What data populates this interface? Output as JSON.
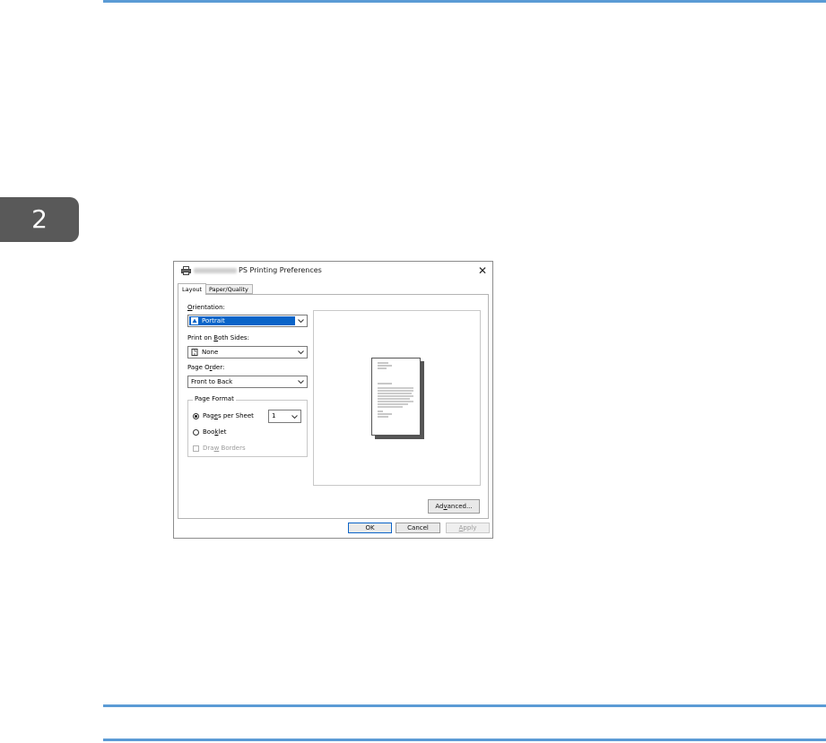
{
  "chapter_number": "2",
  "colors": {
    "rule": "#5b9bd5",
    "chapter_tab": "#595959",
    "selection": "#0a64c8"
  },
  "dialog": {
    "title": "PS Printing Preferences",
    "icons": {
      "printer": "printer-icon",
      "close": "close-icon"
    },
    "tabs": [
      {
        "label": "Layout",
        "selected": true
      },
      {
        "label": "Paper/Quality",
        "selected": false
      }
    ],
    "orientation": {
      "label_pre": "",
      "label_key": "O",
      "label_post": "rientation:",
      "value": "Portrait"
    },
    "both_sides": {
      "label_pre": "Print on ",
      "label_key": "B",
      "label_post": "oth Sides:",
      "value": "None"
    },
    "page_order": {
      "label_pre": "Page O",
      "label_key": "r",
      "label_post": "der:",
      "value": "Front to Back"
    },
    "page_format": {
      "legend": "Page Format",
      "pages_per_sheet": {
        "label_pre": "Pag",
        "label_key": "e",
        "label_post": "s per Sheet",
        "value": "1",
        "checked": true
      },
      "booklet": {
        "label_pre": "Boo",
        "label_key": "k",
        "label_post": "let",
        "checked": false
      },
      "draw_borders": {
        "label_pre": "Dra",
        "label_key": "w",
        "label_post": " Borders",
        "checked": false,
        "enabled": false
      }
    },
    "buttons": {
      "advanced": {
        "pre": "Ad",
        "key": "v",
        "post": "anced..."
      },
      "ok": "OK",
      "cancel": "Cancel",
      "apply": {
        "pre": "",
        "key": "A",
        "post": "pply"
      }
    }
  }
}
